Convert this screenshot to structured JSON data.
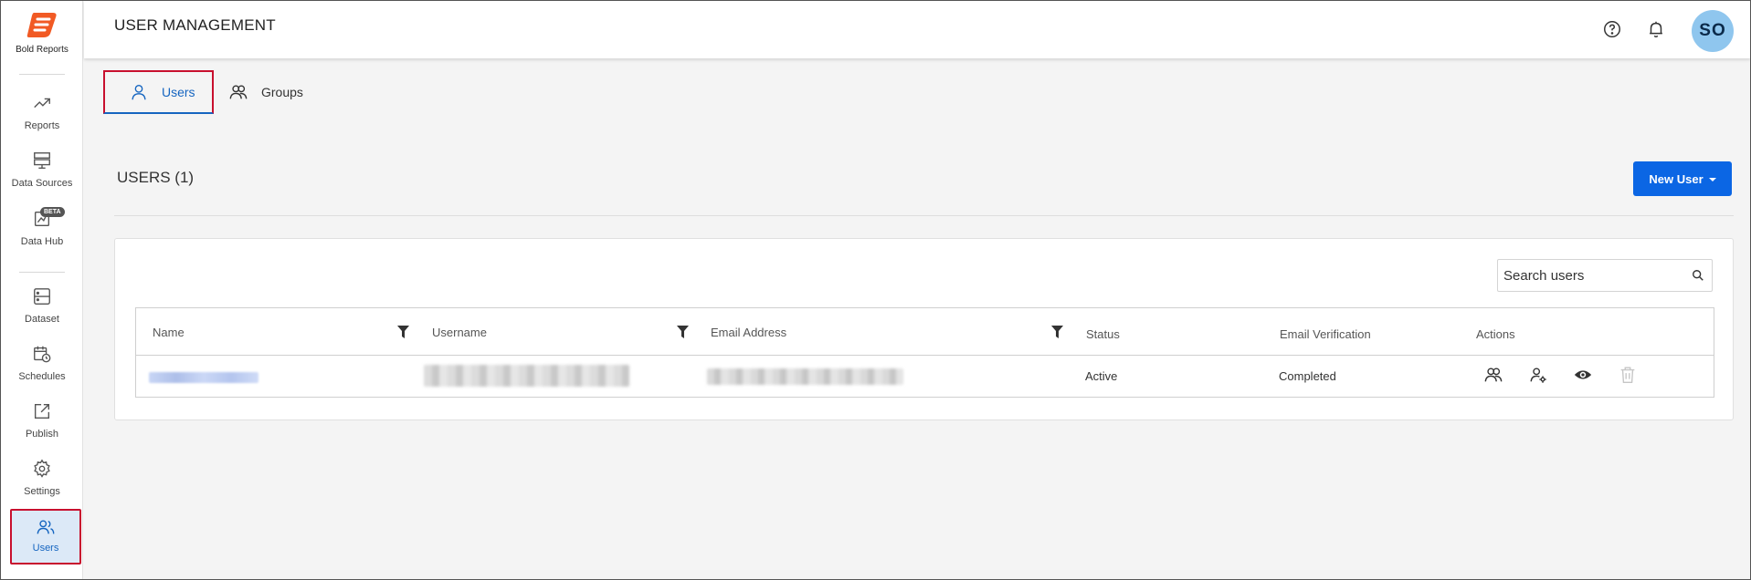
{
  "brand": {
    "name": "Bold Reports",
    "color": "#f15a24"
  },
  "sidebar": {
    "items": [
      {
        "label": "Reports",
        "icon": "trending-up-icon"
      },
      {
        "label": "Data Sources",
        "icon": "server-icon"
      },
      {
        "label": "Data Hub",
        "icon": "data-hub-icon",
        "badge": "BETA"
      },
      {
        "label": "Dataset",
        "icon": "dataset-icon"
      },
      {
        "label": "Schedules",
        "icon": "calendar-clock-icon"
      },
      {
        "label": "Publish",
        "icon": "share-icon"
      },
      {
        "label": "Settings",
        "icon": "gear-icon"
      },
      {
        "label": "Users",
        "icon": "users-icon",
        "active": true
      }
    ]
  },
  "header": {
    "title": "USER MANAGEMENT",
    "avatar_initials": "SO",
    "icons": [
      "help-icon",
      "bell-icon"
    ]
  },
  "tabs": [
    {
      "label": "Users",
      "icon": "user-icon",
      "active": true
    },
    {
      "label": "Groups",
      "icon": "group-icon"
    }
  ],
  "users_section": {
    "title": "USERS (1)",
    "new_user_label": "New User",
    "search_placeholder": "Search users"
  },
  "table": {
    "columns": [
      "Name",
      "Username",
      "Email Address",
      "Status",
      "Email Verification",
      "Actions"
    ],
    "rows": [
      {
        "name": "",
        "username": "",
        "email": "",
        "status": "Active",
        "email_verification": "Completed",
        "actions": [
          "manage-groups-icon",
          "user-settings-icon",
          "view-icon",
          "delete-icon"
        ]
      }
    ]
  },
  "colors": {
    "primary": "#0b66e4",
    "active_blue": "#1565c0",
    "highlight_red": "#c8102e",
    "avatar_bg": "#8fc6ee"
  }
}
